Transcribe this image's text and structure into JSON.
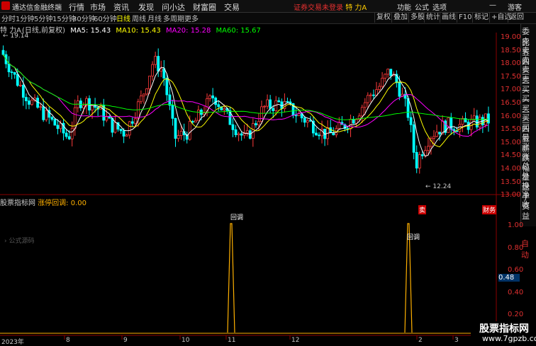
{
  "titlebar": {
    "app_title": "通达信金融终端",
    "menus": [
      "行情",
      "市场",
      "资讯",
      "发现",
      "问小达",
      "财富圈",
      "交易"
    ],
    "trade_warning": "证券交易未登录",
    "stock_name": "特 力A",
    "right_menus": [
      "功能",
      "公式",
      "选项"
    ],
    "guest": "游客",
    "min_icon": "—"
  },
  "periodbar": {
    "periods": [
      "分时",
      "1分钟",
      "5分钟",
      "15分钟",
      "30分钟",
      "60分钟",
      "日线",
      "周线",
      "月线",
      "多周期",
      "更多"
    ],
    "active": "日线",
    "tools": [
      "复权",
      "叠加",
      "多股",
      "统计",
      "画线",
      "F10",
      "标记",
      "+自选",
      "返回"
    ]
  },
  "mahead": {
    "stock": "特 力A",
    "mode": "(日线,前复权)",
    "ma5": "MA5: 15.43",
    "ma10": "MA10: 15.43",
    "ma20": "MA20: 15.28",
    "ma60": "MA60: 15.67"
  },
  "price_labels": {
    "high": "19.14",
    "low": "12.24",
    "low_tag": "卖",
    "right_tag": "财务"
  },
  "right_panel": [
    "委比",
    "卖五",
    "卖四",
    "卖三",
    "卖二",
    "卖一",
    "买一",
    "买二",
    "买三",
    "买四",
    "买五",
    "最新",
    "涨跌",
    "涨幅",
    "总量",
    "外盘",
    "换手",
    "净资",
    "收益"
  ],
  "auto_tab": "自动",
  "price_axis": [
    "19.00",
    "18.50",
    "18.00",
    "17.50",
    "17.00",
    "16.50",
    "16.00",
    "15.50",
    "15.00",
    "14.50",
    "14.00",
    "13.50",
    "13.00"
  ],
  "indicator": {
    "source": "股票指标网",
    "name": "涨停回调: 0.00",
    "formula": "公式源码",
    "axis": [
      "1.00",
      "0.80",
      "0.60",
      "0.40",
      "0.20"
    ],
    "current_value": "0.48",
    "signal_label_1": "回调",
    "signal_label_2": "回调"
  },
  "date_axis": [
    "2023年",
    "8",
    "9",
    "10",
    "11",
    "12",
    "2",
    "3"
  ],
  "watermark": {
    "line1": "股票指标网",
    "line2": "www.7gpzb.com"
  },
  "colors": {
    "up": "#ff3b3b",
    "down": "#00ffff",
    "ma5": "#ffffff",
    "ma10": "#ffff00",
    "ma20": "#ff00ff",
    "ma60": "#00ff00",
    "signal": "#ffb000"
  }
}
